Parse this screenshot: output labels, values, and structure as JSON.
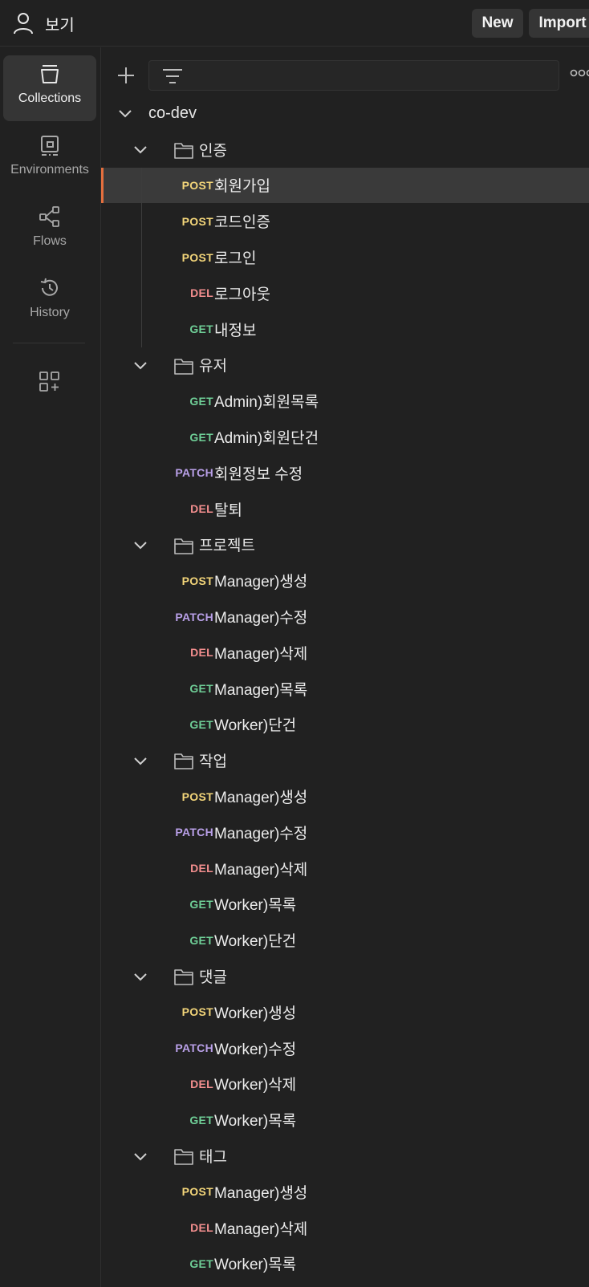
{
  "header": {
    "workspace": "보기",
    "new_label": "New",
    "import_label": "Import"
  },
  "sidebar": {
    "items": [
      {
        "label": "Collections",
        "icon": "collections-icon",
        "active": true
      },
      {
        "label": "Environments",
        "icon": "environments-icon",
        "active": false
      },
      {
        "label": "Flows",
        "icon": "flows-icon",
        "active": false
      },
      {
        "label": "History",
        "icon": "history-icon",
        "active": false
      }
    ]
  },
  "collection": {
    "name": "co-dev",
    "folders": [
      {
        "name": "인증",
        "requests": [
          {
            "method": "POST",
            "name": "회원가입",
            "selected": true
          },
          {
            "method": "POST",
            "name": "코드인증"
          },
          {
            "method": "POST",
            "name": "로그인"
          },
          {
            "method": "DEL",
            "name": "로그아웃"
          },
          {
            "method": "GET",
            "name": "내정보"
          }
        ]
      },
      {
        "name": "유저",
        "requests": [
          {
            "method": "GET",
            "name": "Admin)회원목록"
          },
          {
            "method": "GET",
            "name": "Admin)회원단건"
          },
          {
            "method": "PATCH",
            "name": "회원정보 수정"
          },
          {
            "method": "DEL",
            "name": "탈퇴"
          }
        ]
      },
      {
        "name": "프로젝트",
        "requests": [
          {
            "method": "POST",
            "name": "Manager)생성"
          },
          {
            "method": "PATCH",
            "name": "Manager)수정"
          },
          {
            "method": "DEL",
            "name": "Manager)삭제"
          },
          {
            "method": "GET",
            "name": "Manager)목록"
          },
          {
            "method": "GET",
            "name": "Worker)단건"
          }
        ]
      },
      {
        "name": "작업",
        "requests": [
          {
            "method": "POST",
            "name": "Manager)생성"
          },
          {
            "method": "PATCH",
            "name": "Manager)수정"
          },
          {
            "method": "DEL",
            "name": "Manager)삭제"
          },
          {
            "method": "GET",
            "name": "Worker)목록"
          },
          {
            "method": "GET",
            "name": "Worker)단건"
          }
        ]
      },
      {
        "name": "댓글",
        "requests": [
          {
            "method": "POST",
            "name": "Worker)생성"
          },
          {
            "method": "PATCH",
            "name": "Worker)수정"
          },
          {
            "method": "DEL",
            "name": "Worker)삭제"
          },
          {
            "method": "GET",
            "name": "Worker)목록"
          }
        ]
      },
      {
        "name": "태그",
        "requests": [
          {
            "method": "POST",
            "name": "Manager)생성"
          },
          {
            "method": "DEL",
            "name": "Manager)삭제"
          },
          {
            "method": "GET",
            "name": "Worker)목록"
          }
        ]
      }
    ]
  }
}
